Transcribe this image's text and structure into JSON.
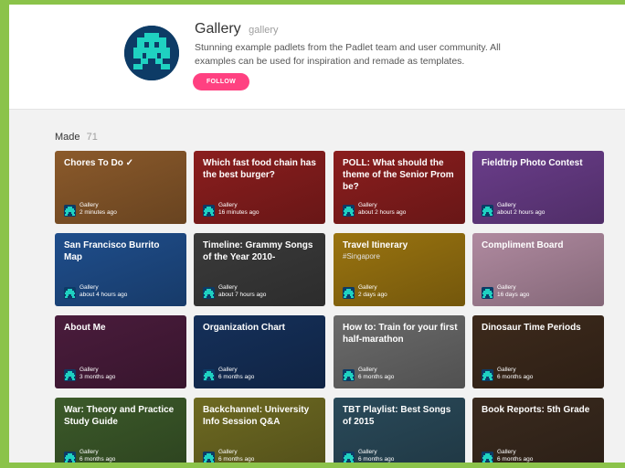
{
  "header": {
    "title": "Gallery",
    "handle": "gallery",
    "description": "Stunning example padlets from the Padlet team and user community. All examples can be used for inspiration and remade as templates.",
    "follow_label": "FOLLOW",
    "follow_color": "#ff4181"
  },
  "section": {
    "label": "Made",
    "count": "71"
  },
  "avatar_icon": "pixel-invader-icon",
  "cards": [
    {
      "title": "Chores To Do ✓",
      "subtitle": "",
      "author": "Gallery",
      "time": "2 minutes ago",
      "bg": "#8b5a2b"
    },
    {
      "title": "Which fast food chain has the best burger?",
      "subtitle": "",
      "author": "Gallery",
      "time": "16 minutes ago",
      "bg": "#8b1e1e"
    },
    {
      "title": "POLL: What should the theme of the Senior Prom be?",
      "subtitle": "",
      "author": "Gallery",
      "time": "about 2 hours ago",
      "bg": "#8b1e1e"
    },
    {
      "title": "Fieldtrip Photo Contest",
      "subtitle": "",
      "author": "Gallery",
      "time": "about 2 hours ago",
      "bg": "#6a3d8a"
    },
    {
      "title": "San Francisco Burrito Map",
      "subtitle": "",
      "author": "Gallery",
      "time": "about 4 hours ago",
      "bg": "#1f4e8c"
    },
    {
      "title": "Timeline: Grammy Songs of the Year 2010-",
      "subtitle": "",
      "author": "Gallery",
      "time": "about 7 hours ago",
      "bg": "#3b3b3b"
    },
    {
      "title": "Travel Itinerary",
      "subtitle": "#Singapore",
      "author": "Gallery",
      "time": "2 days ago",
      "bg": "#9a7410"
    },
    {
      "title": "Compliment Board",
      "subtitle": "",
      "author": "Gallery",
      "time": "16 days ago",
      "bg": "#b08aa0"
    },
    {
      "title": "About Me",
      "subtitle": "",
      "author": "Gallery",
      "time": "3 months ago",
      "bg": "#4a1c3c"
    },
    {
      "title": "Organization Chart",
      "subtitle": "",
      "author": "Gallery",
      "time": "6 months ago",
      "bg": "#15305a"
    },
    {
      "title": "How to: Train for your first half-marathon",
      "subtitle": "",
      "author": "Gallery",
      "time": "6 months ago",
      "bg": "#6b6b6b"
    },
    {
      "title": "Dinosaur Time Periods",
      "subtitle": "",
      "author": "Gallery",
      "time": "6 months ago",
      "bg": "#3d2a1c"
    },
    {
      "title": "War: Theory and Practice Study Guide",
      "subtitle": "",
      "author": "Gallery",
      "time": "6 months ago",
      "bg": "#3c5a2a"
    },
    {
      "title": "Backchannel: University Info Session Q&A",
      "subtitle": "",
      "author": "Gallery",
      "time": "6 months ago",
      "bg": "#6e6a22"
    },
    {
      "title": "TBT Playlist: Best Songs of 2015",
      "subtitle": "",
      "author": "Gallery",
      "time": "6 months ago",
      "bg": "#2a4a5a"
    },
    {
      "title": "Book Reports: 5th Grade",
      "subtitle": "",
      "author": "Gallery",
      "time": "6 months ago",
      "bg": "#3a2a1e"
    }
  ]
}
